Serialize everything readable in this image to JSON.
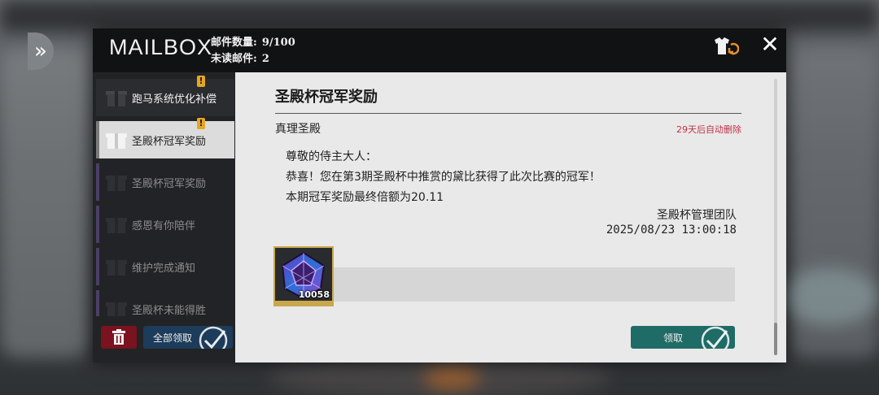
{
  "header": {
    "title": "MAILBOX",
    "mail_count_label": "邮件数量:",
    "mail_count_value": "9/100",
    "unread_label": "未读邮件:",
    "unread_value": "2"
  },
  "sidebar": {
    "items": [
      {
        "label": "跑马系统优化补偿",
        "state": "unread",
        "badge": "!"
      },
      {
        "label": "圣殿杯冠军奖励",
        "state": "active",
        "badge": "!"
      },
      {
        "label": "圣殿杯冠军奖励",
        "state": "read"
      },
      {
        "label": "感恩有你陪伴",
        "state": "read"
      },
      {
        "label": "维护完成通知",
        "state": "read"
      },
      {
        "label": "圣殿杯未能得胜",
        "state": "read"
      }
    ],
    "claim_all_label": "全部领取"
  },
  "mail": {
    "subject": "圣殿杯冠军奖励",
    "sender": "真理圣殿",
    "expire_text": "29天后自动删除",
    "body_lines": [
      "尊敬的侍主大人：",
      "恭喜！您在第3期圣殿杯中推赏的黛比获得了此次比赛的冠军！",
      "本期冠军奖励最终倍额为20.11"
    ],
    "signature": "圣殿杯管理团队",
    "date": "2025/08/23 13:00:18",
    "attachment_qty": "10058",
    "claim_label": "领取"
  },
  "colors": {
    "accent_teal": "#1f6b66",
    "accent_blue": "#1d3b5a",
    "delete_red": "#7a1220",
    "badge_orange": "#e6a623",
    "expire_red": "#c0314a"
  },
  "icons": {
    "close": "close-icon",
    "outfit": "outfit-swap-icon",
    "trash": "trash-icon",
    "gift": "gift-icon",
    "check": "check-icon"
  }
}
